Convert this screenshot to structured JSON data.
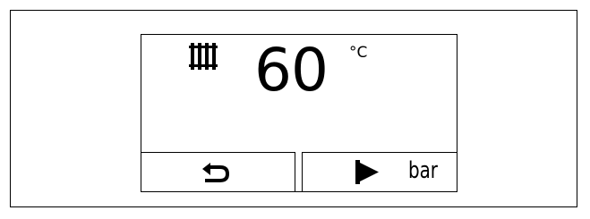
{
  "display": {
    "heating_icon": "radiator-icon",
    "temperature": "60",
    "unit": "°C"
  },
  "softkeys": {
    "left": {
      "icon": "back-arrow-icon"
    },
    "right": {
      "icon": "play-arrow-icon",
      "label": "bar"
    }
  },
  "colors": {
    "foreground": "#000000",
    "background": "#ffffff"
  }
}
